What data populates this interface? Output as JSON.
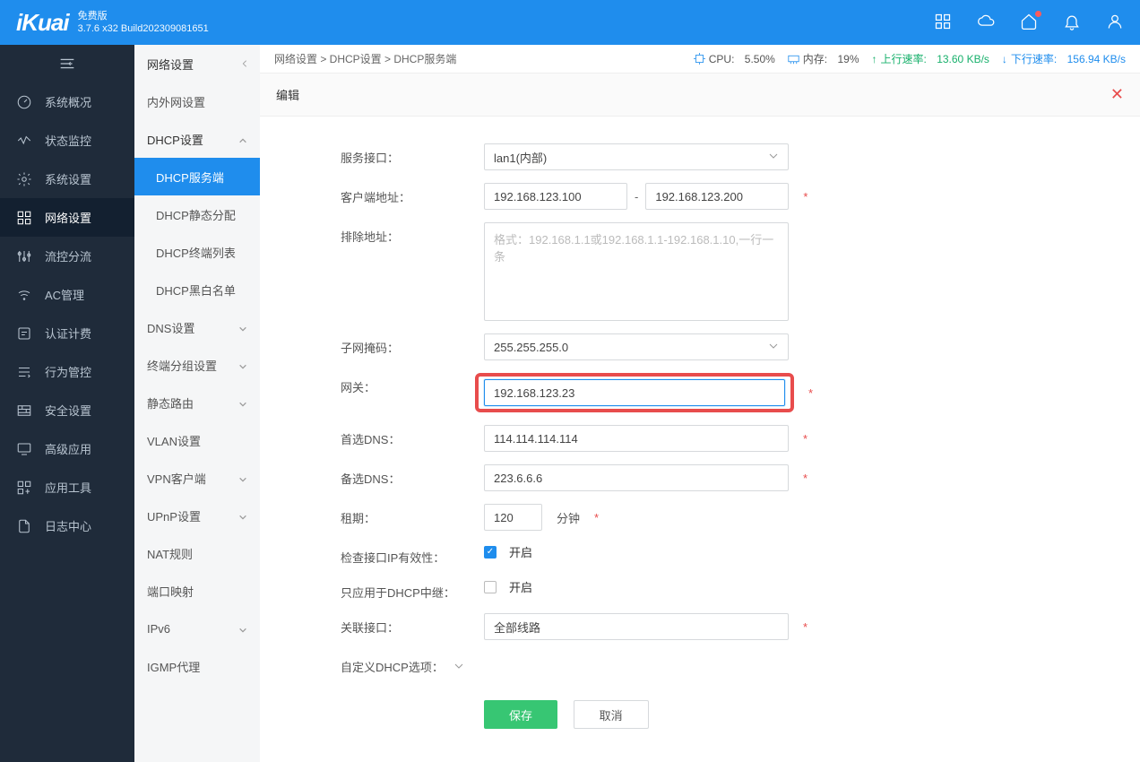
{
  "header": {
    "logo": "iKuai",
    "edition": "免费版",
    "build": "3.7.6 x32 Build202309081651"
  },
  "sideL": {
    "items": [
      {
        "icon": "gauge",
        "label": "系统概况"
      },
      {
        "icon": "wave",
        "label": "状态监控"
      },
      {
        "icon": "gear",
        "label": "系统设置"
      },
      {
        "icon": "net",
        "label": "网络设置"
      },
      {
        "icon": "sliders",
        "label": "流控分流"
      },
      {
        "icon": "wifi",
        "label": "AC管理"
      },
      {
        "icon": "auth",
        "label": "认证计费"
      },
      {
        "icon": "behavior",
        "label": "行为管控"
      },
      {
        "icon": "wall",
        "label": "安全设置"
      },
      {
        "icon": "adv",
        "label": "高级应用"
      },
      {
        "icon": "apps",
        "label": "应用工具"
      },
      {
        "icon": "log",
        "label": "日志中心"
      }
    ]
  },
  "sideM": {
    "title": "网络设置",
    "items": [
      {
        "label": "内外网设置",
        "type": "item"
      },
      {
        "label": "DHCP设置",
        "type": "item",
        "expanded": true
      },
      {
        "label": "DHCP服务端",
        "type": "sub",
        "active": true
      },
      {
        "label": "DHCP静态分配",
        "type": "sub"
      },
      {
        "label": "DHCP终端列表",
        "type": "sub"
      },
      {
        "label": "DHCP黑白名单",
        "type": "sub"
      },
      {
        "label": "DNS设置",
        "type": "item",
        "chev": true
      },
      {
        "label": "终端分组设置",
        "type": "item",
        "chev": true
      },
      {
        "label": "静态路由",
        "type": "item",
        "chev": true
      },
      {
        "label": "VLAN设置",
        "type": "item"
      },
      {
        "label": "VPN客户端",
        "type": "item",
        "chev": true
      },
      {
        "label": "UPnP设置",
        "type": "item",
        "chev": true
      },
      {
        "label": "NAT规则",
        "type": "item"
      },
      {
        "label": "端口映射",
        "type": "item"
      },
      {
        "label": "IPv6",
        "type": "item",
        "chev": true
      },
      {
        "label": "IGMP代理",
        "type": "item"
      }
    ]
  },
  "breadcrumb": "网络设置 > DHCP设置 > DHCP服务端",
  "stats": {
    "cpu_label": "CPU:",
    "cpu": "5.50%",
    "mem_label": "内存:",
    "mem": "19%",
    "up_label": "上行速率:",
    "up": "13.60 KB/s",
    "down_label": "下行速率:",
    "down": "156.94 KB/s"
  },
  "panel": {
    "title": "编辑"
  },
  "form": {
    "labels": {
      "iface": "服务接口：",
      "client_addr": "客户端地址：",
      "exclude": "排除地址：",
      "netmask": "子网掩码：",
      "gateway": "网关：",
      "dns1": "首选DNS：",
      "dns2": "备选DNS：",
      "lease": "租期：",
      "check_ip": "检查接口IP有效性：",
      "relay_only": "只应用于DHCP中继：",
      "assoc_iface": "关联接口：",
      "custom_opt": "自定义DHCP选项："
    },
    "values": {
      "iface": "lan1(内部)",
      "client_start": "192.168.123.100",
      "client_end": "192.168.123.200",
      "exclude_placeholder": "格式：192.168.1.1或192.168.1.1-192.168.1.10,一行一条",
      "netmask": "255.255.255.0",
      "gateway": "192.168.123.23",
      "dns1": "114.114.114.114",
      "dns2": "223.6.6.6",
      "lease": "120",
      "lease_unit": "分钟",
      "enable_text": "开启",
      "assoc_iface": "全部线路"
    },
    "buttons": {
      "save": "保存",
      "cancel": "取消"
    }
  }
}
